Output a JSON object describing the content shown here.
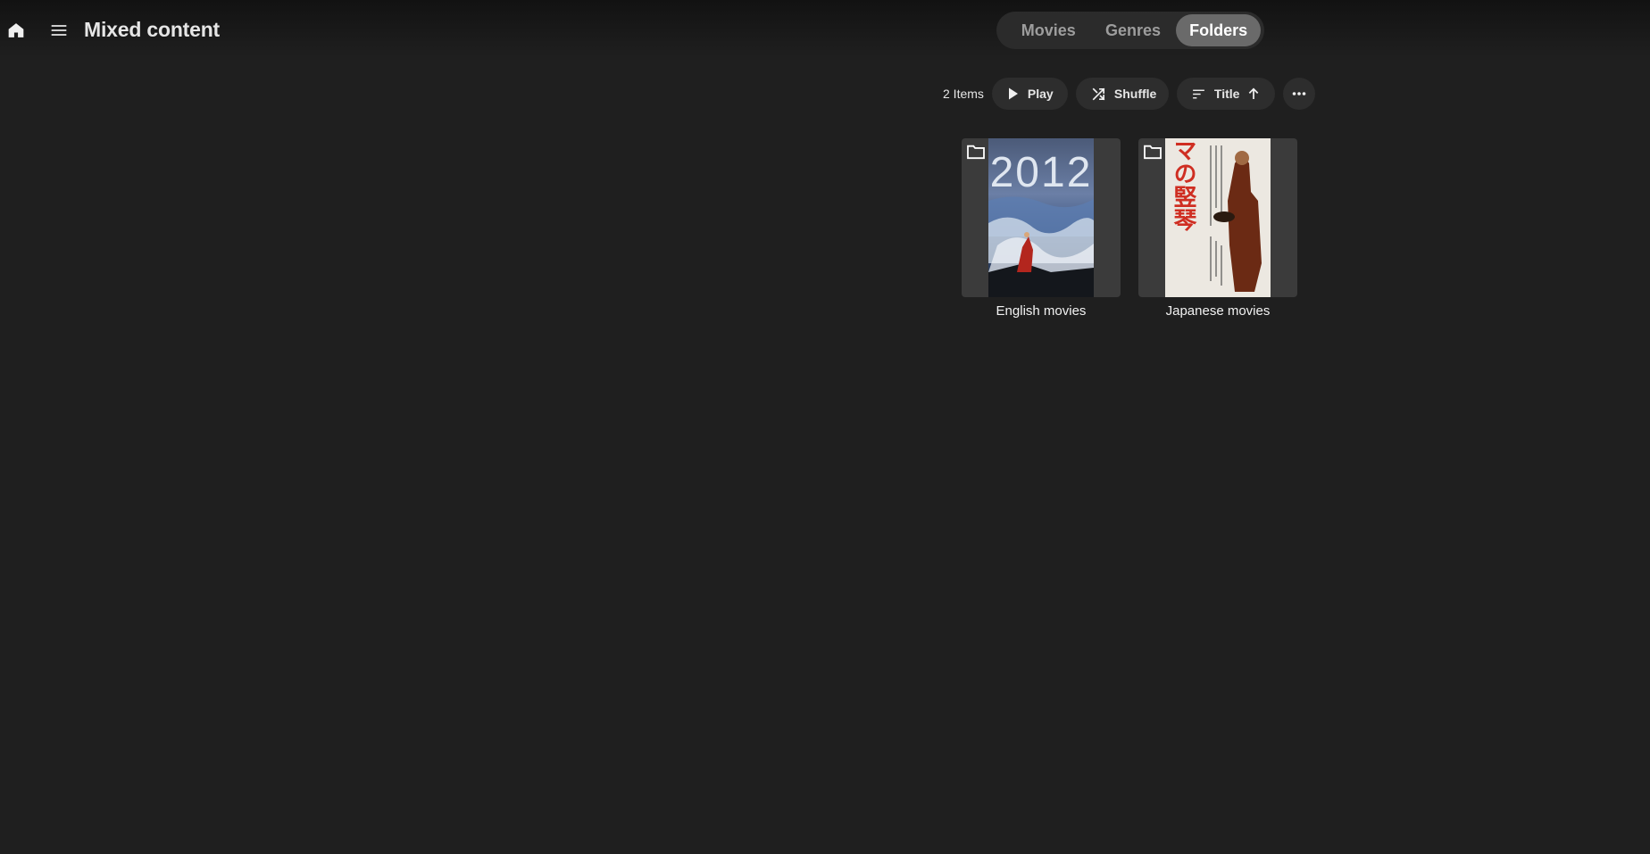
{
  "header": {
    "title": "Mixed content",
    "home_icon": "home-icon",
    "menu_icon": "hamburger-menu-icon"
  },
  "tabs": [
    {
      "label": "Movies",
      "selected": false
    },
    {
      "label": "Genres",
      "selected": false
    },
    {
      "label": "Folders",
      "selected": true
    }
  ],
  "toolbar": {
    "item_count": "2 Items",
    "play_label": "Play",
    "shuffle_label": "Shuffle",
    "sort_label": "Title",
    "sort_direction": "ascending"
  },
  "items": [
    {
      "label": "English movies",
      "poster_text": "2012"
    },
    {
      "label": "Japanese movies",
      "poster_text": "ビルマの竪琴"
    }
  ],
  "colors": {
    "background": "#1f1f1f",
    "tab_selected": "#6a6a6a",
    "pill_background": "#2d2d2d",
    "card_background": "#3b3b3b"
  }
}
